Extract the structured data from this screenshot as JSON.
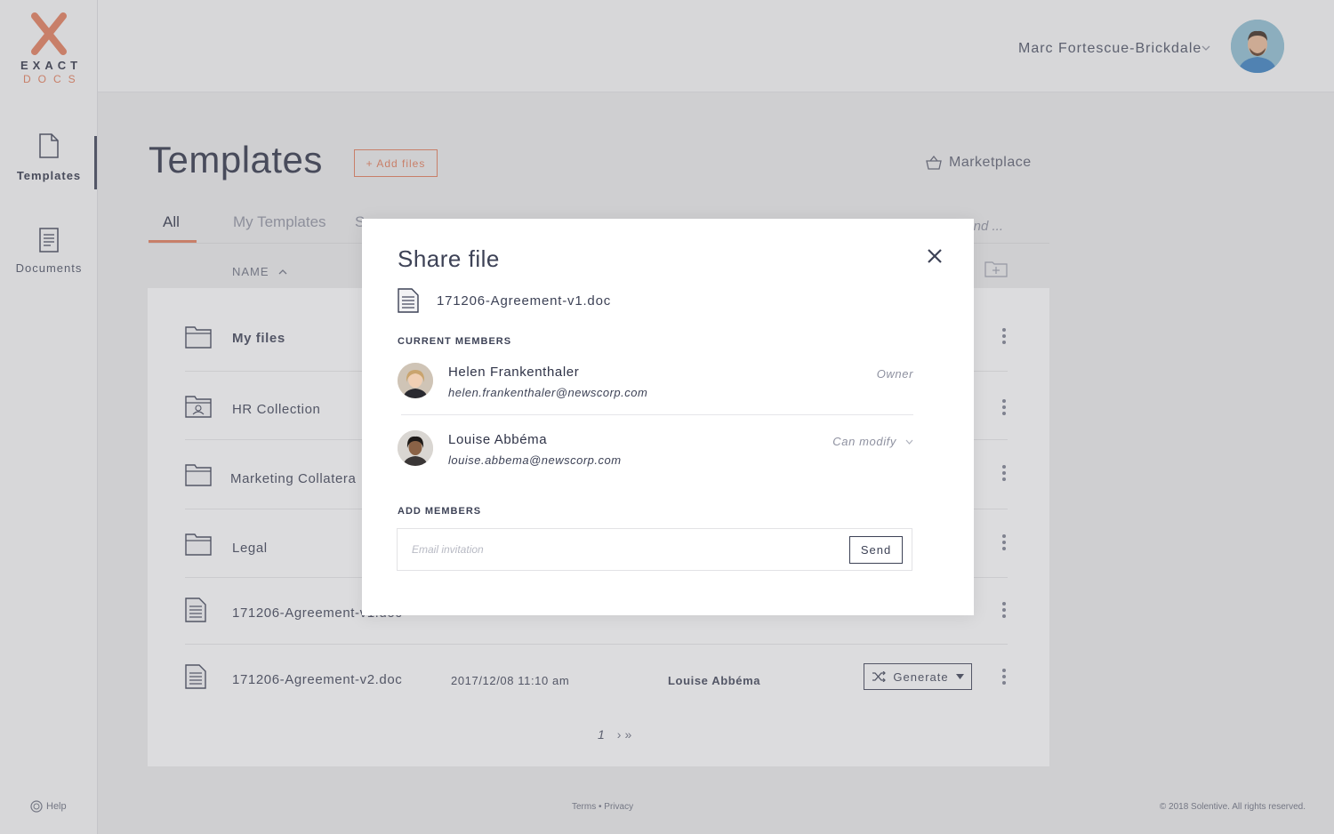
{
  "brand": {
    "word1": "EXACT",
    "word2": "DOCS",
    "accent": "#e07a5a",
    "dark": "#3d4256"
  },
  "sidebar": {
    "items": [
      {
        "label": "Templates",
        "icon": "file-icon",
        "active": true
      },
      {
        "label": "Documents",
        "icon": "document-icon",
        "active": false
      }
    ],
    "help_label": "Help"
  },
  "header": {
    "user_name": "Marc Fortescue-Brickdale"
  },
  "page": {
    "title": "Templates",
    "add_files_label": "+ Add files",
    "marketplace_label": "Marketplace",
    "tabs": [
      {
        "label": "All",
        "active": true
      },
      {
        "label": "My Templates",
        "active": false
      },
      {
        "label": "S",
        "active": false
      }
    ],
    "search_hint": "nd ...",
    "column_name": "NAME"
  },
  "table": {
    "rows": [
      {
        "type": "folder",
        "name": "My files",
        "date": "",
        "owner": ""
      },
      {
        "type": "shared-folder",
        "name": "HR Collection",
        "date": "",
        "owner": ""
      },
      {
        "type": "folder",
        "name": "Marketing Collatera",
        "date": "",
        "owner": ""
      },
      {
        "type": "folder",
        "name": "Legal",
        "date": "",
        "owner": ""
      },
      {
        "type": "file",
        "name": "171206-Agreement-v1.doc",
        "date": "",
        "owner": ""
      },
      {
        "type": "file",
        "name": "171206-Agreement-v2.doc",
        "date": "2017/12/08 11:10 am",
        "owner": "Louise Abbéma",
        "action": "Generate"
      }
    ]
  },
  "pagination": {
    "current": "1",
    "next": "›",
    "last": "»"
  },
  "footer": {
    "links": "Terms • Privacy",
    "copyright": "© 2018  Solentive. All rights reserved."
  },
  "modal": {
    "title": "Share file",
    "file_name": "171206-Agreement-v1.doc",
    "current_members_heading": "CURRENT MEMBERS",
    "members": [
      {
        "name": "Helen Frankenthaler",
        "email": "helen.frankenthaler@newscorp.com",
        "role": "Owner"
      },
      {
        "name": "Louise Abbéma",
        "email": "louise.abbema@newscorp.com",
        "role": "Can modify"
      }
    ],
    "add_members_heading": "ADD MEMBERS",
    "invite_placeholder": "Email invitation",
    "send_label": "Send"
  }
}
